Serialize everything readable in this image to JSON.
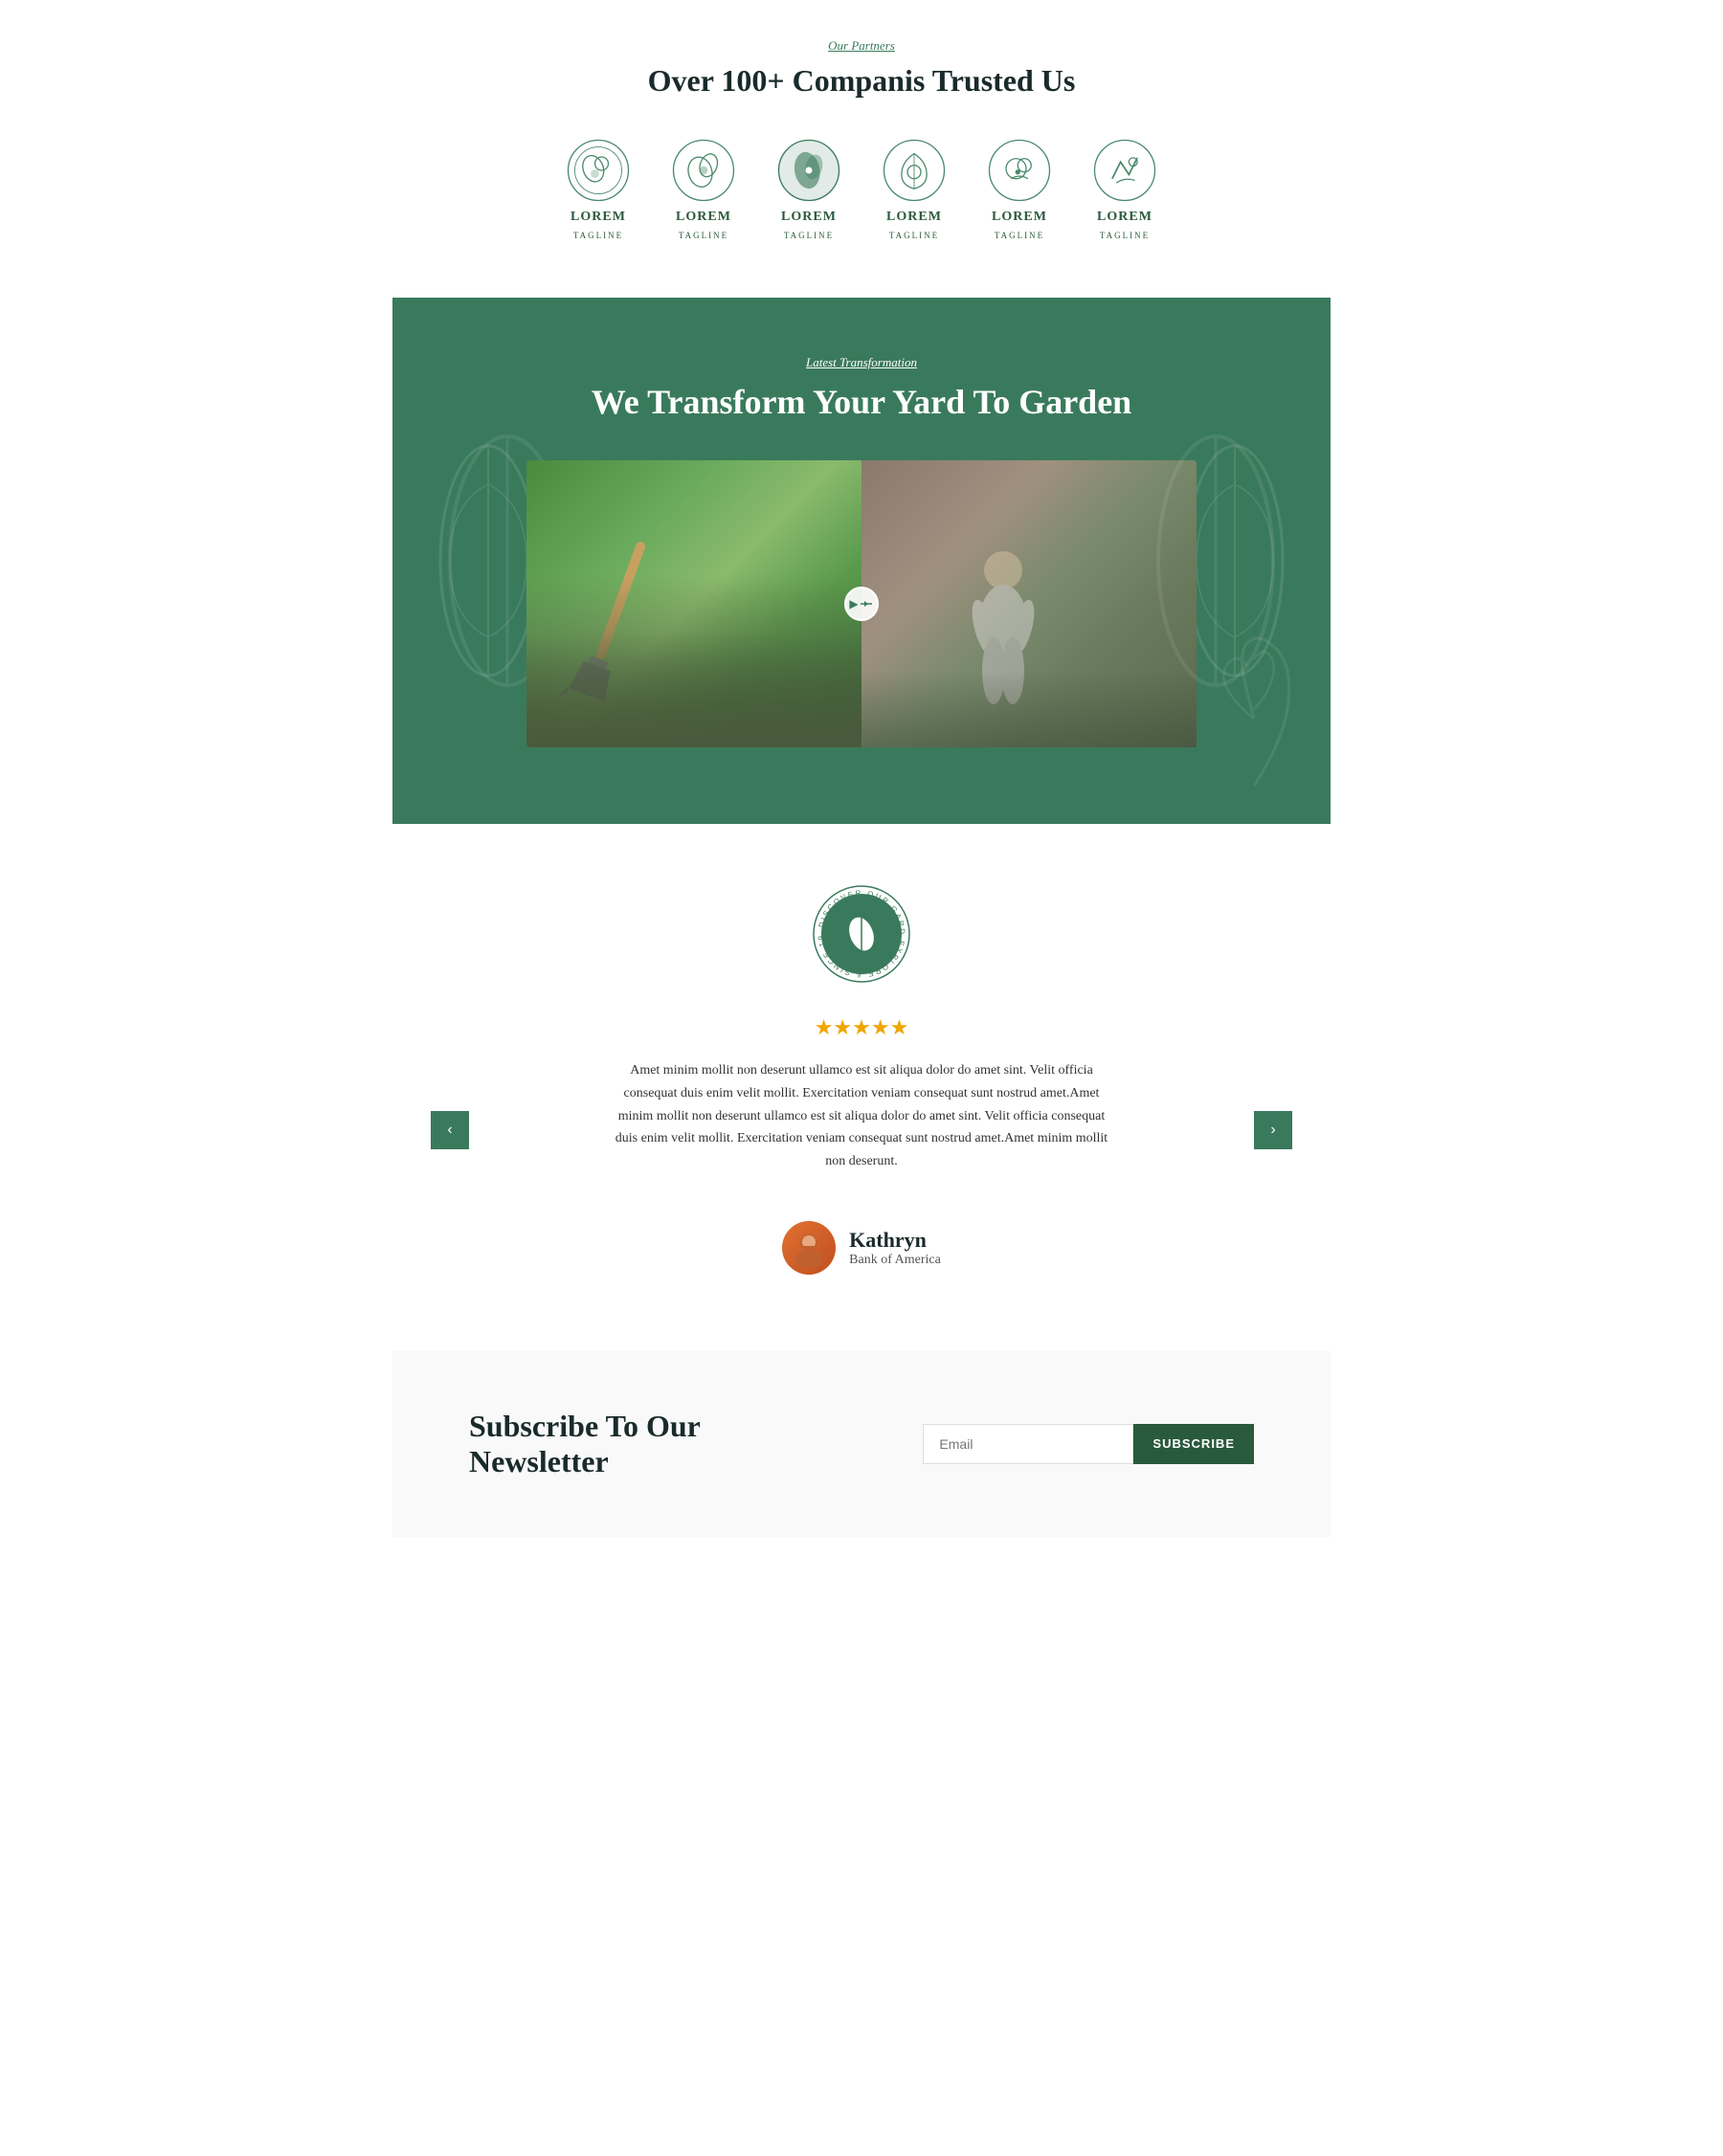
{
  "partners": {
    "label": "Our Partners",
    "title": "Over 100+ Companis Trusted Us",
    "logos": [
      {
        "id": 1,
        "name": "LOREM",
        "tagline": "TAGLINE"
      },
      {
        "id": 2,
        "name": "LOREM",
        "tagline": "TAGLINE"
      },
      {
        "id": 3,
        "name": "LOREM",
        "tagline": "TAGLINE"
      },
      {
        "id": 4,
        "name": "LOREM",
        "tagline": "TAGLINE"
      },
      {
        "id": 5,
        "name": "LOREM",
        "tagline": "TAGLINE"
      },
      {
        "id": 6,
        "name": "LOREM",
        "tagline": "TAGLINE"
      }
    ]
  },
  "transformation": {
    "label": "Latest Transformation",
    "title": "We Transform Your Yard To Garden"
  },
  "badge": {
    "text": "DISCOVER OUR GARDEN · EXPLORE & SINCE 1997 ·"
  },
  "testimonial": {
    "stars": "★★★★★",
    "text": "Amet minim mollit non deserunt ullamco est sit aliqua dolor do amet sint. Velit officia consequat duis enim velit mollit. Exercitation veniam consequat sunt nostrud amet.Amet minim mollit non deserunt ullamco est sit aliqua dolor do amet sint. Velit officia consequat duis enim velit mollit. Exercitation veniam consequat sunt nostrud amet.Amet minim mollit non deserunt.",
    "reviewer_name": "Kathryn",
    "reviewer_company": "Bank of America",
    "prev_label": "‹",
    "next_label": "›"
  },
  "newsletter": {
    "title": "Subscribe To Our Newsletter",
    "input_placeholder": "Email",
    "button_label": "SUBSCRIBE"
  }
}
